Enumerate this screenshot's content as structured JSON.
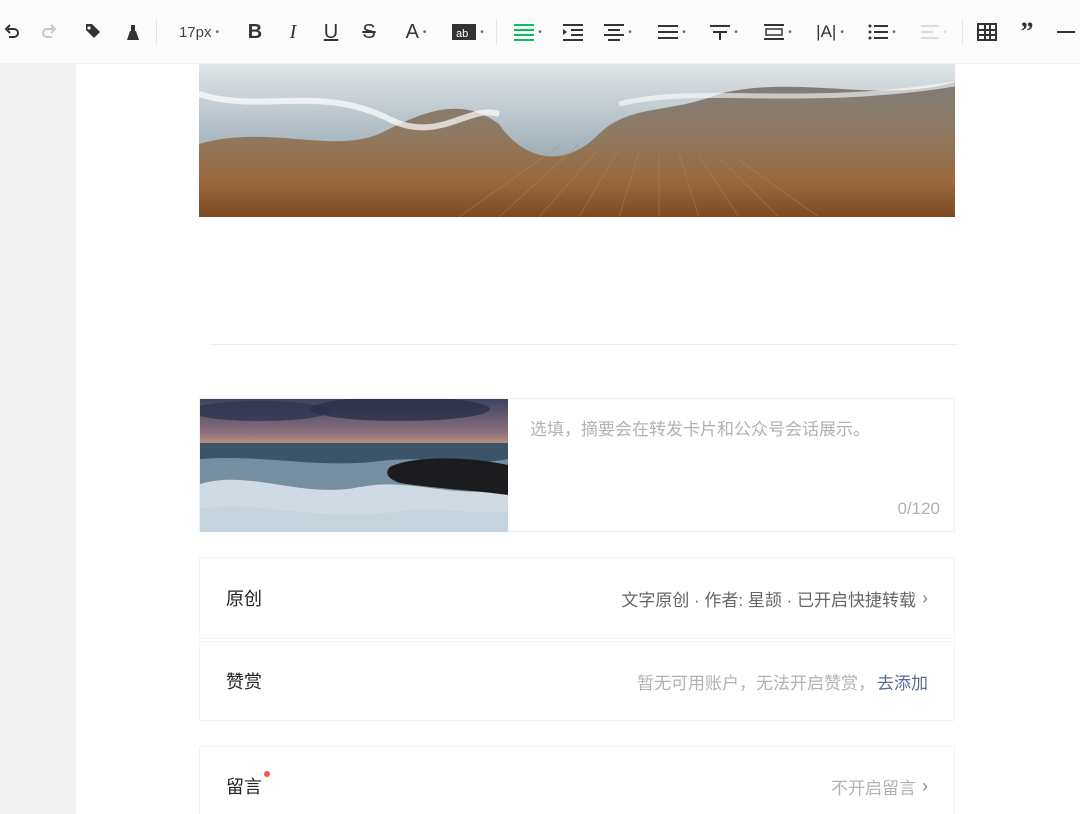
{
  "toolbar": {
    "font_size": "17px",
    "icons": [
      "undo-icon",
      "redo-icon",
      "format-painter-icon",
      "clear-format-icon",
      "bold-icon",
      "italic-icon",
      "underline-icon",
      "strikethrough-icon",
      "font-color-icon",
      "background-color-icon",
      "align-left-icon",
      "indent-icon",
      "align-center-icon",
      "line-height-icon",
      "paragraph-spacing-icon",
      "paragraph-indent-icon",
      "letter-spacing-icon",
      "list-icon",
      "text-direction-icon",
      "table-icon",
      "quote-icon",
      "divider-icon"
    ],
    "accent": "#07c160"
  },
  "summary": {
    "placeholder": "选填，摘要会在转发卡片和公众号会话展示。",
    "count": "0/120"
  },
  "settings": {
    "original": {
      "label": "原创",
      "value": "文字原创 · 作者: 星颉 · 已开启快捷转载"
    },
    "reward": {
      "label": "赞赏",
      "value": "暂无可用账户，无法开启赞赏，",
      "link": "去添加"
    },
    "comments": {
      "label": "留言",
      "value": "不开启留言"
    }
  },
  "colors": {
    "link": "#576b95",
    "required": "#fa5151",
    "placeholder": "#b2b2b2"
  }
}
